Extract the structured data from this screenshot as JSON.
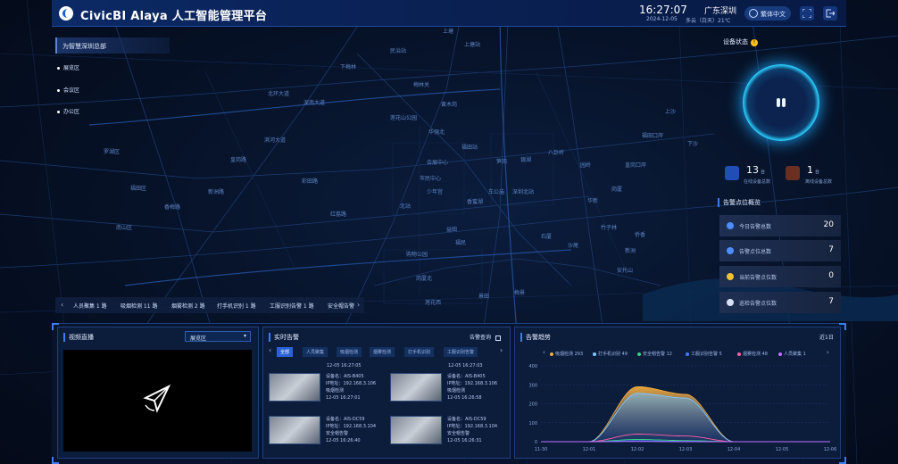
{
  "header": {
    "title": "CivicBI Alaya 人工智能管理平台",
    "time": "16:27:07",
    "date": "2024-12-05",
    "city": "广东深圳",
    "weather": "多云（白天）21℃",
    "language_button": "繁体中文"
  },
  "map_labels": [
    "上塘",
    "上塘站",
    "民治站",
    "下梅林",
    "梅林关",
    "黄木岗",
    "莲花山公园",
    "华强北",
    "福田站",
    "会展中心",
    "市民中心",
    "少年宫",
    "香蜜湖",
    "车公庙",
    "深圳北站",
    "银湖",
    "笋岗",
    "八卦岭",
    "园岭",
    "华新",
    "岗厦",
    "皇岗口岸",
    "福田口岸",
    "上沙",
    "下沙",
    "新洲",
    "竹子林",
    "侨香",
    "安托山",
    "沙尾",
    "石厦",
    "福民",
    "益田",
    "购物公园",
    "岗厦北",
    "莲花西",
    "景田",
    "梅景",
    "北站",
    "红荔路",
    "深南大道",
    "北环大道",
    "滨河大道",
    "彩田路",
    "皇岗路",
    "新洲路",
    "香梅路",
    "福田区",
    "罗湖区",
    "南山区"
  ],
  "tree": {
    "root": "为智慧深圳总部",
    "items": [
      "展览区",
      "会议区",
      "办公区"
    ]
  },
  "device_status": {
    "title": "设备状态",
    "warn_glyph": "!",
    "online": {
      "value": "13",
      "unit": "台",
      "label": "在线设备总数"
    },
    "offline": {
      "value": "1",
      "unit": "台",
      "label": "离线设备总数"
    }
  },
  "alarm_overview": {
    "title": "告警点位概览",
    "rows": [
      {
        "label": "今日告警总数",
        "value": "20",
        "icon": "people-icon",
        "color": "#4f8cff"
      },
      {
        "label": "告警点位总数",
        "value": "7",
        "icon": "location-icon",
        "color": "#4f8cff"
      },
      {
        "label": "当前告警点位数",
        "value": "0",
        "icon": "bulb-icon",
        "color": "#f2c230"
      },
      {
        "label": "巡检告警点位数",
        "value": "7",
        "icon": "camera-icon",
        "color": "#d7e2f5"
      }
    ]
  },
  "alarm_strip": {
    "items": [
      "人员聚集 1 路",
      "吸烟检测 11 路",
      "烟雾检测 2 路",
      "打手机识别 1 路",
      "工服识别告警 1 路",
      "安全帽告警"
    ]
  },
  "video_panel": {
    "title": "视频直播",
    "select_value": "展览区"
  },
  "alert_panel": {
    "title": "实时告警",
    "more": "告警查询",
    "tabs": [
      "全部",
      "人员聚集",
      "吸烟检测",
      "烟雾检测",
      "打手机识别",
      "工服识别告警"
    ],
    "entries": [
      {
        "device": "设备名：AIS-B405",
        "ip": "IP地址：192.168.3.106",
        "type": "吸烟检测",
        "time": "12-05 16:27:01"
      },
      {
        "device": "设备名：AIS-B405",
        "ip": "IP地址：192.168.3.106",
        "type": "吸烟检测",
        "time": "12-05 16:26:58"
      },
      {
        "device": "设备名：AIS-DC59",
        "ip": "IP地址：192.168.3.104",
        "type": "安全帽告警",
        "time": "12-05 16:26:40"
      },
      {
        "device": "设备名：AIS-DC59",
        "ip": "IP地址：192.168.3.104",
        "type": "安全帽告警",
        "time": "12-05 16:26:31"
      }
    ],
    "partial_top": [
      "12-05 16:27:05",
      "12-05 16:27:03"
    ]
  },
  "trend_panel": {
    "title": "告警趋势",
    "date_label": "近1日"
  },
  "chart_data": {
    "type": "area",
    "x": [
      "11-30",
      "12-01",
      "12-02",
      "12-03",
      "12-04",
      "12-05",
      "12-06"
    ],
    "ylim": [
      0,
      400
    ],
    "yticks": [
      0,
      100,
      200,
      300,
      400
    ],
    "legend_placement": "top",
    "series": [
      {
        "name": "吸烟检测 293",
        "color": "#f2a93b",
        "values": [
          0,
          0,
          290,
          250,
          0,
          0,
          0
        ]
      },
      {
        "name": "打手机识别 49",
        "color": "#7fc8ff",
        "values": [
          0,
          0,
          255,
          230,
          0,
          0,
          0
        ]
      },
      {
        "name": "安全帽告警 12",
        "color": "#35d07f",
        "values": [
          0,
          0,
          12,
          6,
          0,
          0,
          0
        ]
      },
      {
        "name": "工服识别告警 5",
        "color": "#3f7bff",
        "values": [
          0,
          0,
          5,
          2,
          0,
          0,
          0
        ]
      },
      {
        "name": "烟雾检测 48",
        "color": "#ff5fa2",
        "values": [
          0,
          0,
          40,
          30,
          0,
          0,
          0
        ]
      },
      {
        "name": "人员聚集 1",
        "color": "#c070ff",
        "values": [
          0,
          0,
          1,
          0,
          0,
          0,
          0
        ]
      }
    ]
  }
}
